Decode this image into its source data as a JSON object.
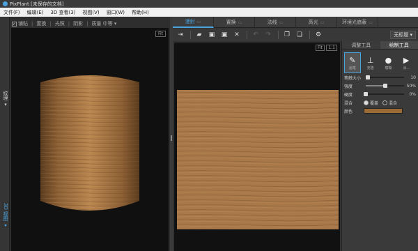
{
  "window": {
    "title": "PixPlant [未保存的文档]"
  },
  "menu": [
    "文件(F)",
    "编辑(E)",
    "3D 查看(3)",
    "视图(V)",
    "窗口(W)",
    "帮助(H)"
  ],
  "left_tabs": {
    "tab1": "纹理 ▾",
    "tab2": "3D 视图 ▾"
  },
  "view3d": {
    "toolbar": {
      "check": "✓",
      "tile": "铺贴",
      "smooth": "置换",
      "light": "光照",
      "shadow": "阴影",
      "quality_label": "质量",
      "quality_value": "中等 ▾"
    },
    "fit": "Fit",
    "colors": {
      "wood_dark": "#7a5530",
      "wood_mid": "#a9784a",
      "wood_light": "#c79a63",
      "background": "#101010"
    }
  },
  "tabs": [
    {
      "label": "漫射",
      "icon": "camera-icon",
      "active": true
    },
    {
      "label": "置换",
      "icon": "camera-icon",
      "active": false
    },
    {
      "label": "法线",
      "icon": "camera-icon",
      "active": false
    },
    {
      "label": "高光",
      "icon": "camera-icon",
      "active": false
    },
    {
      "label": "环境光遮蔽",
      "icon": "camera-icon",
      "active": false
    }
  ],
  "toolbar": {
    "items": [
      "import-icon",
      "open-icon",
      "save-icon",
      "save-as-icon",
      "close-icon",
      "undo-icon",
      "redo-icon",
      "copy-icon",
      "paste-icon",
      "settings-icon"
    ],
    "untitled": "无标题 ▾"
  },
  "view2d": {
    "fit": "Fit",
    "scale": "1:1"
  },
  "props": {
    "tabs": [
      {
        "label": "调整工具",
        "active": false
      },
      {
        "label": "绘制工具",
        "active": true
      }
    ],
    "tools": [
      {
        "label": "画笔",
        "icon": "brush-icon",
        "active": true
      },
      {
        "label": "克隆",
        "icon": "clone-icon",
        "active": false
      },
      {
        "label": "模糊",
        "icon": "blur-icon",
        "active": false
      },
      {
        "label": "涂...",
        "icon": "more-icon",
        "active": false
      }
    ],
    "rows": [
      {
        "label": "笔触大小",
        "value": "10",
        "pos": 0.05
      },
      {
        "label": "强度",
        "value": "50%",
        "pos": 0.5
      },
      {
        "label": "硬度",
        "value": "0%",
        "pos": 0.0
      }
    ],
    "blend": {
      "label": "混合",
      "opt1": "覆盖",
      "opt2": "混合"
    },
    "color": {
      "label": "颜色",
      "value": "#9b6a35"
    }
  }
}
